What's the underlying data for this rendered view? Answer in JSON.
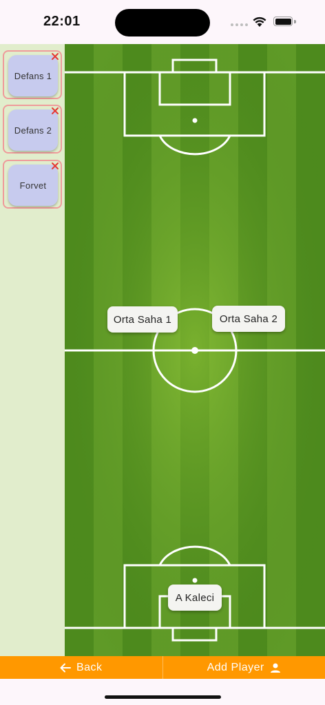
{
  "status_bar": {
    "time": "22:01"
  },
  "bench": [
    {
      "label": "Defans 1"
    },
    {
      "label": "Defans 2"
    },
    {
      "label": "Forvet"
    }
  ],
  "field": {
    "players": [
      {
        "label": "Orta Saha 1"
      },
      {
        "label": "Orta Saha 2"
      },
      {
        "label": "A Kaleci"
      }
    ]
  },
  "bottom_bar": {
    "back_label": "Back",
    "add_player_label": "Add Player"
  },
  "colors": {
    "accent": "#ff9800",
    "pitch_light": "#6fa62e",
    "pitch_dark": "#4f8a1f",
    "chip": "#c7cbee",
    "remove": "#e53935"
  }
}
